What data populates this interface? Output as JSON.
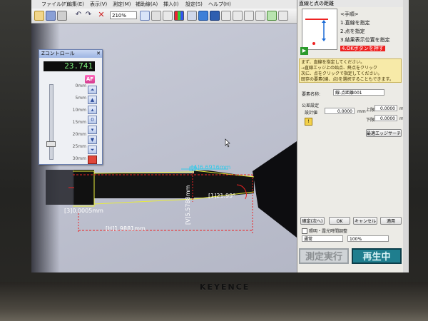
{
  "menu": {
    "items": [
      "ファイル(F)",
      "編集(E)",
      "表示(V)",
      "測定(M)",
      "補助線(A)",
      "挿入(I)",
      "設定(S)",
      "ヘルプ(H)"
    ]
  },
  "toolbar": {
    "zoom_value": "210%"
  },
  "zpanel": {
    "title": "Zコントロール",
    "value": "23.741",
    "af_label": "AF",
    "ticks": [
      "0mm",
      "5mm",
      "10mm",
      "15mm",
      "20mm",
      "25mm",
      "30mm"
    ]
  },
  "measurements": {
    "a_label": "[A]6.6916mm",
    "b_label": "[1]21.99°",
    "c_label": "[3]0.0005mm",
    "d_label": "[H]1.9881mm",
    "v_label": "[V]5.5788mm"
  },
  "panel": {
    "title": "直線と点の距離",
    "steps_header": "<手順>",
    "steps": [
      "1.直線を指定",
      "2.点を指定",
      "3.結果表示位置を指定",
      "4.OKボタンを押す"
    ],
    "hint_lines": [
      "まず、直線を指定してください。",
      "→直線エッジ上の始点、終点をクリック",
      "次に、点をクリックで指定してください。",
      "既存の要素(線、点)を選択することもできます。"
    ],
    "name_label": "要素名称:",
    "name_value": "線-点距離001",
    "tolerance_label": "公差設定",
    "design_label": "設計値",
    "design_value": "0.0000",
    "upper_label": "上限",
    "upper_value": "0.0000",
    "lower_label": "下限",
    "lower_value": "0.0000",
    "unit": "mm",
    "edge_button": "最適エッジサーチ",
    "buttons": [
      "確定(次へ)",
      "OK",
      "キャンセル",
      "適用"
    ],
    "checkbox_label": "照明・露光時間調整",
    "mode_label": "通常",
    "percent_label": "100%"
  },
  "status": {
    "measure_button": "測定実行",
    "playback_button": "再生中"
  },
  "brand": "KEYENCE",
  "colors": {
    "accent_red": "#e22222",
    "measure_yellow": "#e8ec3a",
    "measure_cyan": "#35c9e8",
    "playback_bg": "#1f7e8e"
  }
}
